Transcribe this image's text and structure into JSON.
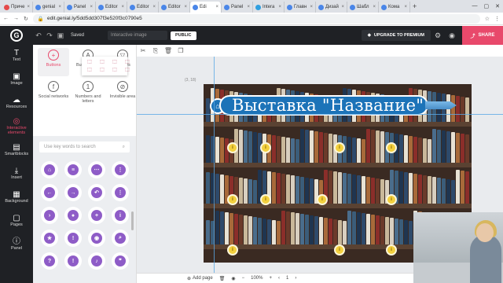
{
  "browser": {
    "tabs": [
      {
        "label": "Приче",
        "color": "#e54a4a"
      },
      {
        "label": "genial",
        "color": "#4a86e8"
      },
      {
        "label": "Panel",
        "color": "#4a86e8"
      },
      {
        "label": "Editor",
        "color": "#4a86e8"
      },
      {
        "label": "Editor",
        "color": "#4a86e8"
      },
      {
        "label": "Editor",
        "color": "#4a86e8"
      },
      {
        "label": "Edi",
        "color": "#4a86e8",
        "active": true
      },
      {
        "label": "Panel",
        "color": "#4a86e8"
      },
      {
        "label": "Intera",
        "color": "#30a0e0"
      },
      {
        "label": "Главн",
        "color": "#4a86e8"
      },
      {
        "label": "Дизай",
        "color": "#4a86e8"
      },
      {
        "label": "Шабл",
        "color": "#4a86e8"
      },
      {
        "label": "Кома",
        "color": "#4a86e8"
      }
    ],
    "url": "edit.genial.ly/5dd5dd307f3e520f3c0790e5"
  },
  "appbar": {
    "saved": "Saved",
    "title_placeholder": "Interactive image",
    "public": "PUBLIC",
    "upgrade": "UPGRADE TO PREMIUM",
    "share": "SHARE"
  },
  "rail": [
    {
      "label": "Text",
      "icon": "T"
    },
    {
      "label": "Image",
      "icon": "▣"
    },
    {
      "label": "Resources",
      "icon": "☁"
    },
    {
      "label": "Interactive elements",
      "icon": "◎",
      "active": true
    },
    {
      "label": "Smartblocks",
      "icon": "▤"
    },
    {
      "label": "Insert",
      "icon": "⤓"
    },
    {
      "label": "Background",
      "icon": "▦"
    },
    {
      "label": "Pages",
      "icon": "▢"
    },
    {
      "label": "Panel",
      "icon": "ⓘ"
    }
  ],
  "panel": {
    "categories": [
      {
        "label": "Buttons",
        "icon": "+",
        "selected": true
      },
      {
        "label": "Buttons with text",
        "icon": "A"
      },
      {
        "label": "Markers",
        "icon": "▽"
      },
      {
        "label": "Social networks",
        "icon": "f"
      },
      {
        "label": "Numbers and letters",
        "icon": "1"
      },
      {
        "label": "Invisible area",
        "icon": "⊘"
      }
    ],
    "search_placeholder": "Use key words to search",
    "icons": [
      "⌂",
      "≡",
      "⋯",
      "⋮",
      "←",
      "→",
      "↶",
      "⋮",
      "›",
      "●",
      "+",
      "i",
      "★",
      "!",
      "◉",
      "⌕",
      "?",
      "!",
      "♪",
      "❞"
    ]
  },
  "canvas": {
    "coord": "(3, 18)",
    "title": "Выставка \"Название\""
  },
  "bottombar": {
    "add_page": "Add page",
    "zoom": "100%",
    "page": "1"
  }
}
